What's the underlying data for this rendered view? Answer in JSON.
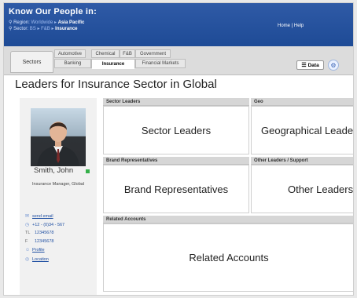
{
  "header": {
    "title": "Know Our People in:",
    "region_label": "Region:",
    "region_path": [
      "Worldwide",
      "Asia Pacific"
    ],
    "sector_label": "Sector:",
    "sector_path": [
      "BS",
      "F&B",
      "Insurance"
    ],
    "links": [
      "Home",
      "Help"
    ]
  },
  "tabs": {
    "sectors_label": "Sectors",
    "row1": [
      "Automotive",
      "Chemical",
      "F&B",
      "Government"
    ],
    "row2": [
      "Banking",
      "Insurance",
      "Financial Markets"
    ],
    "active": "Insurance",
    "data_button": "Data"
  },
  "page": {
    "title": "Leaders for Insurance Sector in Global"
  },
  "profile": {
    "name": "Smith, John",
    "role": "Insurance Manager, Global",
    "status_color": "#35b04a",
    "contacts": [
      {
        "icon": "envelope-icon",
        "label": "",
        "value": "send email"
      },
      {
        "icon": "phone-icon",
        "label": "",
        "value": "+12 - (0)34 - 567"
      },
      {
        "icon": "telephone-icon",
        "label": "TL",
        "value": "12345678"
      },
      {
        "icon": "fax-icon",
        "label": "F",
        "value": "12345678"
      },
      {
        "icon": "profile-icon",
        "label": "",
        "value": "Profile"
      },
      {
        "icon": "location-icon",
        "label": "",
        "value": "Location"
      }
    ]
  },
  "sections": {
    "sector_leaders": {
      "header": "Sector Leaders",
      "body": "Sector Leaders"
    },
    "geo": {
      "header": "Geo",
      "body": "Geographical Leaders"
    },
    "brand_reps": {
      "header": "Brand Representatives",
      "body": "Brand Representatives"
    },
    "other_leaders": {
      "header": "Other Leaders / Support",
      "body": "Other Leaders"
    },
    "related_accounts": {
      "header": "Related Accounts",
      "body": "Related Accounts"
    }
  },
  "colors": {
    "topbar": "#1e4b96",
    "accent": "#35b04a"
  }
}
